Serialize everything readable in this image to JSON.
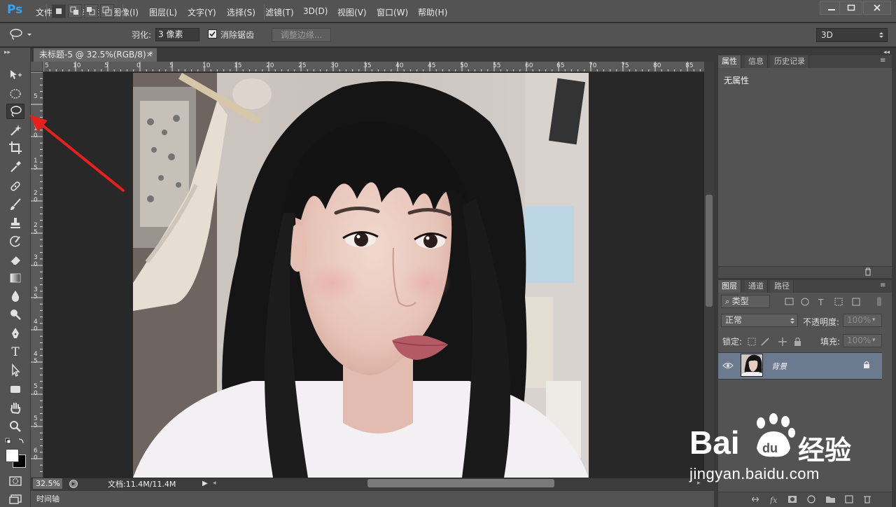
{
  "app": {
    "logo": "Ps",
    "menu": [
      "文件(F)",
      "编辑(E)",
      "图像(I)",
      "图层(L)",
      "文字(Y)",
      "选择(S)",
      "滤镜(T)",
      "3D(D)",
      "视图(V)",
      "窗口(W)",
      "帮助(H)"
    ]
  },
  "options_bar": {
    "feather_label": "羽化:",
    "feather_value": "3 像素",
    "antialias_label": "消除锯齿",
    "antialias_checked": true,
    "refine_edge_label": "调整边缘...",
    "workspace": "3D"
  },
  "document": {
    "tab_title": "未标题-5 @ 32.5%(RGB/8) *",
    "tab_close": "×",
    "zoom": "32.5%",
    "doc_info": "文档:11.4M/11.4M"
  },
  "rulers": {
    "horizontal": [
      "5",
      "10",
      "5",
      "0",
      "5",
      "10",
      "15",
      "20",
      "25",
      "30",
      "35",
      "40",
      "45",
      "50",
      "55",
      "60",
      "65",
      "70",
      "75",
      "80",
      "85"
    ],
    "vertical": [
      "5",
      "1 0",
      "1 5",
      "2 0",
      "2 5",
      "3 0",
      "3 5",
      "4 0",
      "4 5",
      "5 0",
      "5 5",
      "6 0"
    ]
  },
  "tools": [
    {
      "icon": "move-icon"
    },
    {
      "icon": "elliptical-marquee-icon"
    },
    {
      "icon": "lasso-icon",
      "active": true
    },
    {
      "icon": "magic-wand-icon"
    },
    {
      "icon": "crop-icon"
    },
    {
      "icon": "eyedropper-icon"
    },
    {
      "icon": "healing-brush-icon"
    },
    {
      "icon": "brush-icon"
    },
    {
      "icon": "clone-stamp-icon"
    },
    {
      "icon": "history-brush-icon"
    },
    {
      "icon": "eraser-icon"
    },
    {
      "icon": "gradient-icon"
    },
    {
      "icon": "blur-icon"
    },
    {
      "icon": "dodge-icon"
    },
    {
      "icon": "pen-icon"
    },
    {
      "icon": "type-icon",
      "glyph": "T"
    },
    {
      "icon": "path-selection-icon"
    },
    {
      "icon": "rectangle-icon"
    },
    {
      "icon": "hand-icon"
    },
    {
      "icon": "zoom-icon"
    }
  ],
  "panels": {
    "properties_tabs": [
      "属性",
      "信息",
      "历史记录"
    ],
    "properties_text": "无属性",
    "layers_tabs": [
      "图层",
      "通道",
      "路径"
    ],
    "filter_kind": "类型",
    "blend_mode": "正常",
    "opacity_label": "不透明度:",
    "opacity_value": "100%",
    "lock_label": "锁定:",
    "fill_label": "填充:",
    "fill_value": "100%",
    "layer_name": "背景"
  },
  "timeline": {
    "label": "时间轴"
  },
  "watermark": {
    "brand": "Bai  经验",
    "url": "jingyan.baidu.com"
  },
  "colors": {
    "accent": "#3aa0f0",
    "annotation_arrow": "#e8201c",
    "selected_layer": "#6b7a8e"
  }
}
